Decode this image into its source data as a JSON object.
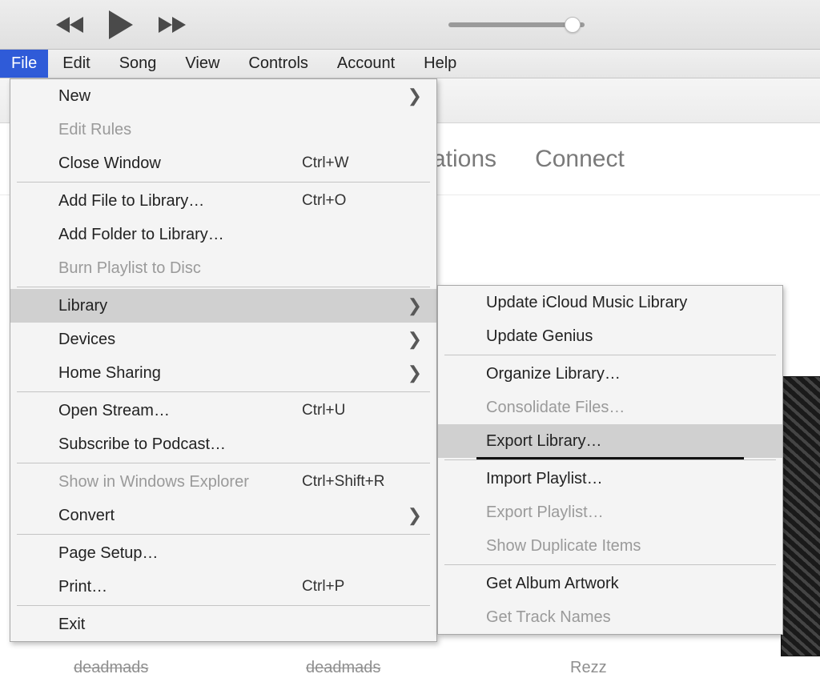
{
  "menubar": {
    "items": [
      "File",
      "Edit",
      "Song",
      "View",
      "Controls",
      "Account",
      "Help"
    ],
    "selected_index": 0
  },
  "file_menu": [
    {
      "label": "New",
      "shortcut": "",
      "submenu": true
    },
    {
      "label": "Edit Rules",
      "disabled": true
    },
    {
      "label": "Close Window",
      "shortcut": "Ctrl+W"
    },
    {
      "sep": true
    },
    {
      "label": "Add File to Library…",
      "shortcut": "Ctrl+O"
    },
    {
      "label": "Add Folder to Library…"
    },
    {
      "label": "Burn Playlist to Disc",
      "disabled": true
    },
    {
      "sep": true
    },
    {
      "label": "Library",
      "submenu": true,
      "highlight": true
    },
    {
      "label": "Devices",
      "submenu": true
    },
    {
      "label": "Home Sharing",
      "submenu": true
    },
    {
      "sep": true
    },
    {
      "label": "Open Stream…",
      "shortcut": "Ctrl+U"
    },
    {
      "label": "Subscribe to Podcast…"
    },
    {
      "sep": true
    },
    {
      "label": "Show in Windows Explorer",
      "shortcut": "Ctrl+Shift+R",
      "disabled": true
    },
    {
      "label": "Convert",
      "submenu": true
    },
    {
      "sep": true
    },
    {
      "label": "Page Setup…"
    },
    {
      "label": "Print…",
      "shortcut": "Ctrl+P"
    },
    {
      "sep": true
    },
    {
      "label": "Exit"
    }
  ],
  "library_submenu": [
    {
      "label": "Update iCloud Music Library"
    },
    {
      "label": "Update Genius"
    },
    {
      "sep": true
    },
    {
      "label": "Organize Library…"
    },
    {
      "label": "Consolidate Files…",
      "disabled": true
    },
    {
      "label": "Export Library…",
      "highlight": true,
      "underline": true
    },
    {
      "sep": true
    },
    {
      "label": "Import Playlist…"
    },
    {
      "label": "Export Playlist…",
      "disabled": true
    },
    {
      "label": "Show Duplicate Items",
      "disabled": true
    },
    {
      "sep": true
    },
    {
      "label": "Get Album Artwork"
    },
    {
      "label": "Get Track Names",
      "disabled": true
    }
  ],
  "bg_tabs": {
    "tab_a_fragment": "ations",
    "tab_b": "Connect"
  },
  "artists": {
    "a": "deadmads",
    "b": "deadmads",
    "c": "Rezz"
  }
}
